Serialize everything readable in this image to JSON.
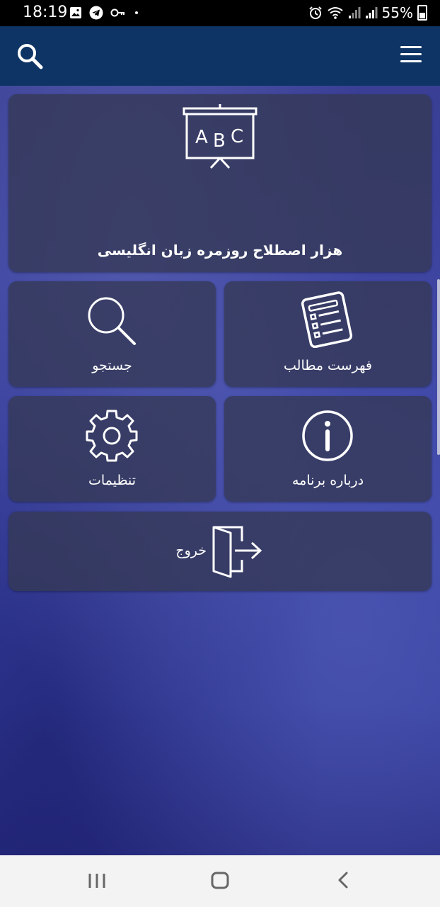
{
  "status_bar": {
    "time": "18:19",
    "battery": "55%",
    "left_icons": [
      "gallery-icon",
      "telegram-icon",
      "key-icon",
      "dot-icon"
    ],
    "right_icons": [
      "alarm-icon",
      "wifi-icon",
      "signal-icon",
      "signal-icon",
      "battery-icon"
    ]
  },
  "header": {
    "left_icon": "search-icon",
    "right_icon": "menu-icon",
    "color": "#0d3464"
  },
  "tiles": {
    "banner": {
      "label": "هزار اصطلاح روزمره زبان انگلیسی",
      "icon": "abc-board-icon"
    },
    "search": {
      "label": "جستجو",
      "icon": "search-icon"
    },
    "contents": {
      "label": "فهرست مطالب",
      "icon": "list-icon"
    },
    "settings": {
      "label": "تنظیمات",
      "icon": "gear-icon"
    },
    "about": {
      "label": "درباره برنامه",
      "icon": "info-icon"
    },
    "exit": {
      "label": "خروج",
      "icon": "exit-door-icon"
    }
  },
  "nav": {
    "items": [
      "recent-apps-icon",
      "home-icon",
      "back-icon"
    ]
  }
}
